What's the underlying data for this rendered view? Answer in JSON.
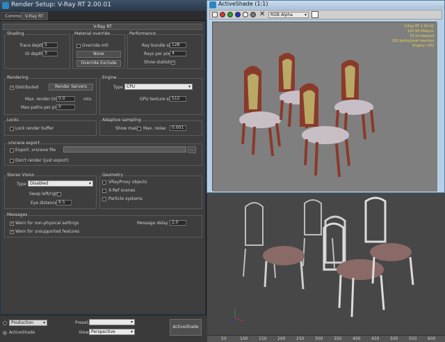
{
  "render_setup": {
    "title": "Render Setup: V-Ray RT 2.00.01",
    "tabs": [
      "Common",
      "V-Ray RT"
    ],
    "rollout": "V-Ray RT",
    "shading": {
      "label": "Shading",
      "trace_depth_label": "Trace depth",
      "trace_depth": "5",
      "gi_depth_label": "GI depth",
      "gi_depth": "3"
    },
    "material_override": {
      "label": "Material override",
      "override_mtl_label": "Override mtl",
      "none_btn": "None",
      "exclude_btn": "Override Exclude"
    },
    "performance": {
      "label": "Performance",
      "ray_bundle_label": "Ray bundle size",
      "ray_bundle": "128",
      "rays_pixel_label": "Rays per pixel",
      "rays_pixel": "4",
      "show_stats_label": "Show statistics"
    },
    "rendering": {
      "label": "Rendering",
      "distributed_label": "Distributed",
      "render_servers_btn": "Render Servers",
      "max_time_label": "Max. render time",
      "max_time": "0.0",
      "min_label": "min.",
      "max_paths_label": "Max paths per pixel",
      "max_paths": "0"
    },
    "engine": {
      "label": "Engine",
      "type_label": "Type",
      "type_value": "CPU",
      "gpu_tex_label": "GPU texture size",
      "gpu_tex": "512"
    },
    "locks": {
      "label": "Locks",
      "lock_buffer_label": "Lock render buffer"
    },
    "adaptive": {
      "label": "Adaptive sampling",
      "show_mask_label": "Show mask",
      "max_noise_label": "Max. noise",
      "max_noise": "0.001"
    },
    "vrscene": {
      "label": ".vrscene export",
      "export_label": "Export .vrscene file",
      "browse_btn": "...",
      "dont_render_label": "Don't render (just export)"
    },
    "stereo": {
      "label": "Stereo Vision",
      "type_label": "Type",
      "type_value": "Disabled",
      "swap_label": "Swap left/right",
      "eye_label": "Eye distance",
      "eye_value": "6.5"
    },
    "geometry": {
      "label": "Geometry",
      "proxy_label": "VRayProxy objects",
      "xref_label": "X-Ref scenes",
      "particle_label": "Particle systems"
    },
    "messages": {
      "label": "Messages",
      "warn_phys_label": "Warn for non-physical settings",
      "warn_unsup_label": "Warn for unsupported features",
      "delay_label": "Message delay (s)",
      "delay_value": "2.0"
    },
    "bottom": {
      "production_label": "Production",
      "activeshade_label": "ActiveShade",
      "preset_label": "Preset:",
      "view_label": "View:",
      "view_value": "Perspective",
      "activeshade_btn": "ActiveShade"
    }
  },
  "activeshade": {
    "title": "ActiveShade (1:1)",
    "channel": "RGB Alpha",
    "overlay": [
      "V-Ray RT 2.00.01",
      "125.94 kRays/s",
      "33.5s elapsed",
      "162 paths/pixel reached",
      "Engine: CPU"
    ]
  },
  "viewport": {
    "ruler": [
      "50",
      "100",
      "150",
      "200",
      "250",
      "300",
      "350",
      "400",
      "450",
      "500",
      "550",
      "600"
    ]
  },
  "colors": {
    "panel": "#3e3e3e",
    "titlebar": "#2a3a4c",
    "overlay_text": "#e8d44d"
  }
}
